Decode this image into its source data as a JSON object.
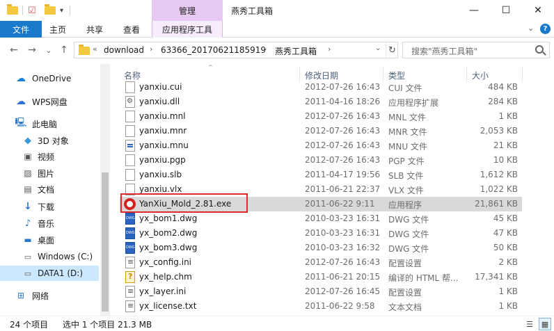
{
  "titlebar": {
    "manage_tab": "管理",
    "window_title": "燕秀工具箱",
    "minimize": "—",
    "maximize": "☐",
    "close": "✕"
  },
  "ribbon": {
    "tabs": [
      "文件",
      "主页",
      "共享",
      "查看",
      "应用程序工具"
    ],
    "expand": "⌄",
    "help": "?"
  },
  "address": {
    "back": "←",
    "forward": "→",
    "recent": "⌄",
    "up": "↑",
    "overflow": "«",
    "crumbs": [
      "download",
      "63366_20170621185919",
      "燕秀工具箱"
    ],
    "sep": "›",
    "dropdown": "⌄",
    "refresh": "↻"
  },
  "search": {
    "placeholder": "搜索\"燕秀工具箱\""
  },
  "sidebar": {
    "items": [
      {
        "label": "OneDrive",
        "icon": "cloud-icon"
      },
      {
        "label": "WPS网盘",
        "icon": "cloud-icon"
      },
      {
        "label": "此电脑",
        "icon": "computer-icon"
      },
      {
        "label": "3D 对象",
        "icon": "cube-icon"
      },
      {
        "label": "视频",
        "icon": "video-icon"
      },
      {
        "label": "图片",
        "icon": "picture-icon"
      },
      {
        "label": "文档",
        "icon": "document-icon"
      },
      {
        "label": "下载",
        "icon": "download-icon"
      },
      {
        "label": "音乐",
        "icon": "music-icon"
      },
      {
        "label": "桌面",
        "icon": "desktop-icon"
      },
      {
        "label": "Windows (C:)",
        "icon": "drive-icon"
      },
      {
        "label": "DATA1 (D:)",
        "icon": "drive-icon"
      },
      {
        "label": "网络",
        "icon": "network-icon"
      }
    ]
  },
  "columns": {
    "name": "名称",
    "date": "修改日期",
    "type": "类型",
    "size": "大小",
    "sort_caret": "^"
  },
  "files": [
    {
      "name": "yanxiu.cui",
      "date": "2012-07-26 16:43",
      "type": "CUI 文件",
      "size": "484 KB",
      "icon": "file"
    },
    {
      "name": "yanxiu.dll",
      "date": "2011-04-16 18:26",
      "type": "应用程序扩展",
      "size": "284 KB",
      "icon": "gear"
    },
    {
      "name": "yanxiu.mnl",
      "date": "2012-07-26 16:43",
      "type": "MNL 文件",
      "size": "1 KB",
      "icon": "file"
    },
    {
      "name": "yanxiu.mnr",
      "date": "2012-07-26 16:43",
      "type": "MNR 文件",
      "size": "2,053 KB",
      "icon": "file"
    },
    {
      "name": "yanxiu.mnu",
      "date": "2012-07-26 16:43",
      "type": "MNU 文件",
      "size": "21 KB",
      "icon": "mnu"
    },
    {
      "name": "yanxiu.pgp",
      "date": "2012-07-26 16:43",
      "type": "PGP 文件",
      "size": "10 KB",
      "icon": "file"
    },
    {
      "name": "yanxiu.slb",
      "date": "2011-04-17 19:56",
      "type": "SLB 文件",
      "size": "1,612 KB",
      "icon": "file"
    },
    {
      "name": "yanxiu.vlx",
      "date": "2011-06-21 22:37",
      "type": "VLX 文件",
      "size": "1,022 KB",
      "icon": "file"
    },
    {
      "name": "YanXiu_Mold_2.81.exe",
      "date": "2011-06-22 9:11",
      "type": "应用程序",
      "size": "21,861 KB",
      "icon": "exe"
    },
    {
      "name": "yx_bom1.dwg",
      "date": "2010-03-23 16:31",
      "type": "DWG 文件",
      "size": "45 KB",
      "icon": "dwg"
    },
    {
      "name": "yx_bom2.dwg",
      "date": "2010-03-23 16:31",
      "type": "DWG 文件",
      "size": "47 KB",
      "icon": "dwg"
    },
    {
      "name": "yx_bom3.dwg",
      "date": "2010-03-23 16:32",
      "type": "DWG 文件",
      "size": "50 KB",
      "icon": "dwg"
    },
    {
      "name": "yx_config.ini",
      "date": "2012-07-26 16:43",
      "type": "配置设置",
      "size": "2 KB",
      "icon": "ini"
    },
    {
      "name": "yx_help.chm",
      "date": "2011-06-21 20:15",
      "type": "编译的 HTML 帮...",
      "size": "17,341 KB",
      "icon": "chm"
    },
    {
      "name": "yx_layer.ini",
      "date": "2012-07-26 16:45",
      "type": "配置设置",
      "size": "1 KB",
      "icon": "ini"
    },
    {
      "name": "yx_license.txt",
      "date": "2011-06-22 9:58",
      "type": "文本文档",
      "size": "1 KB",
      "icon": "ini"
    }
  ],
  "status": {
    "count": "24 个项目",
    "selection": "选中 1 个项目 21.3 MB",
    "details_view": "☰",
    "icons_view": "▦"
  }
}
